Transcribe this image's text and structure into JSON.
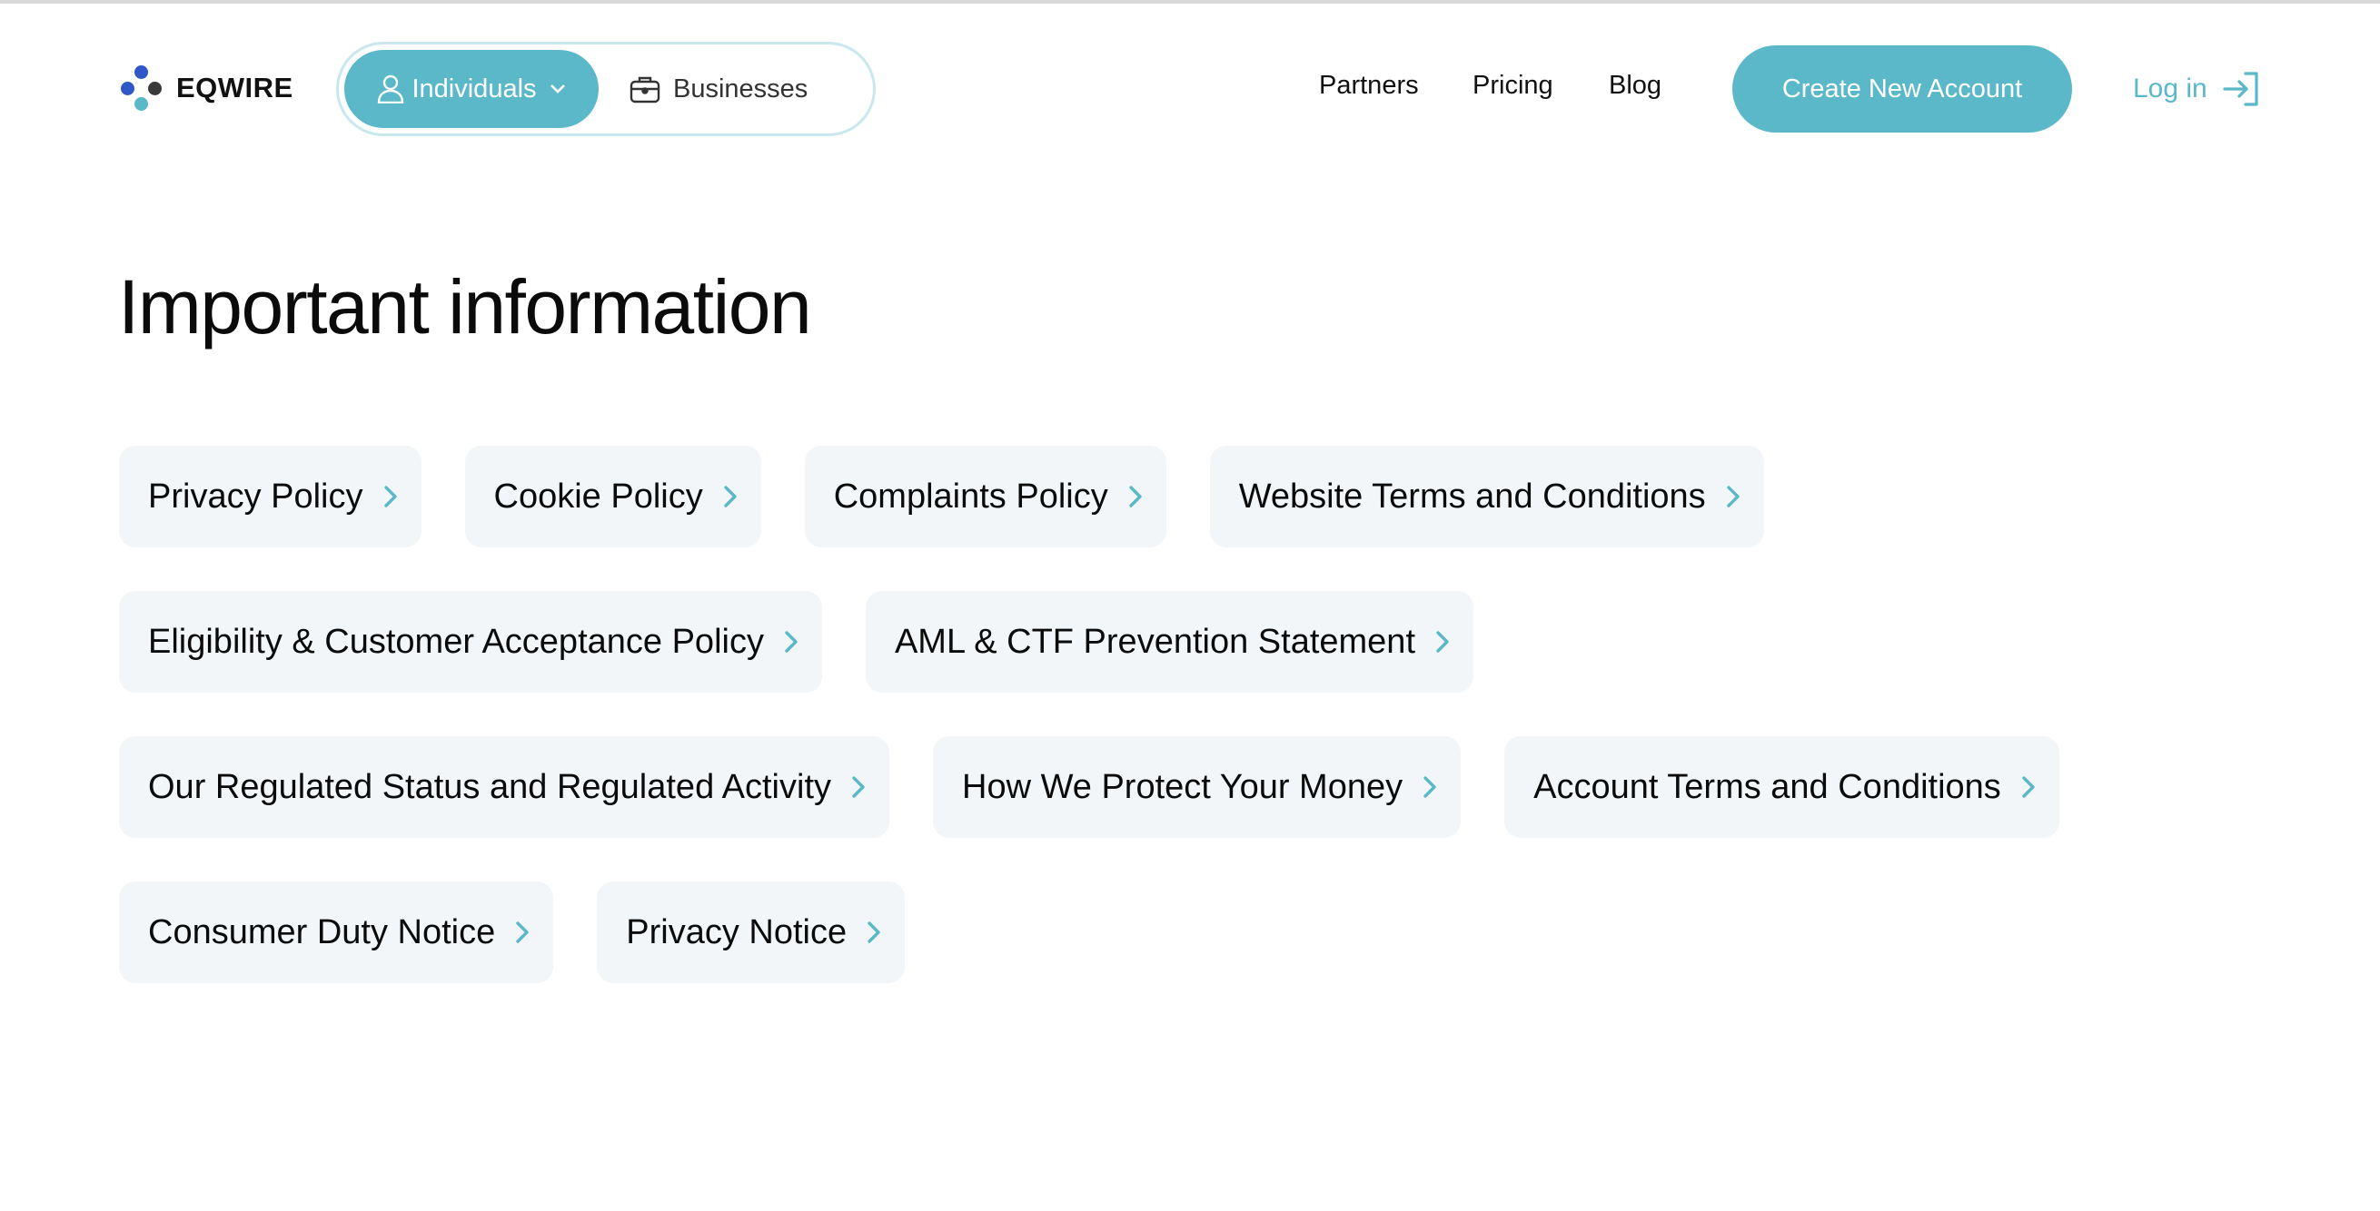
{
  "brand": {
    "name": "EQWIRE"
  },
  "segment": {
    "individuals_label": "Individuals",
    "businesses_label": "Businesses"
  },
  "nav": {
    "partners": "Partners",
    "pricing": "Pricing",
    "blog": "Blog",
    "create_account": "Create New Account",
    "login": "Log in"
  },
  "main": {
    "title": "Important information",
    "links": [
      [
        "Privacy Policy",
        "Cookie Policy",
        "Complaints Policy",
        "Website Terms and Conditions"
      ],
      [
        "Eligibility & Customer Acceptance Policy",
        "AML & CTF Prevention Statement"
      ],
      [
        "Our Regulated Status and Regulated Activity",
        "How We Protect Your Money",
        "Account Terms and Conditions"
      ],
      [
        "Consumer Duty Notice",
        "Privacy Notice"
      ]
    ]
  },
  "colors": {
    "accent": "#5ab8c9",
    "chip_bg": "#f2f6f9",
    "logo_blue": "#2f57c8",
    "logo_dark": "#3a3a3a"
  },
  "icons": {
    "individuals": "user-icon",
    "individuals_caret": "chevron-down-icon",
    "businesses": "briefcase-icon",
    "login": "login-arrow-icon",
    "chip": "chevron-right-icon"
  }
}
